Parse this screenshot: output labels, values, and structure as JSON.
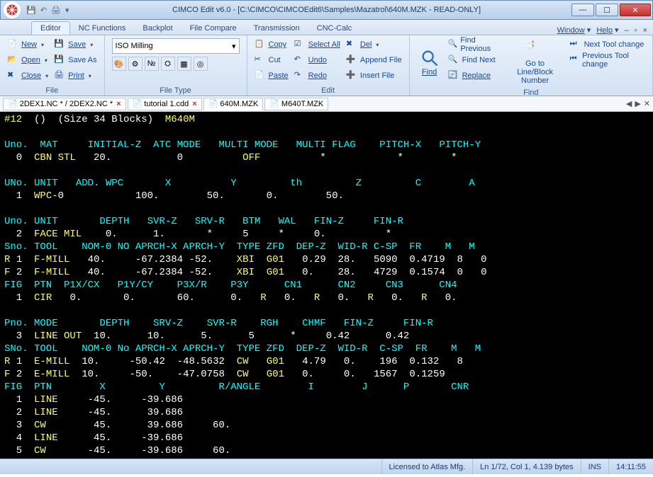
{
  "title": "CIMCO Edit v6.0 - [C:\\CIMCO\\CIMCOEdit6\\Samples\\Mazatrol\\640M.MZK - READ-ONLY]",
  "tabs": {
    "editor": "Editor",
    "nc": "NC Functions",
    "backplot": "Backplot",
    "compare": "File Compare",
    "trans": "Transmission",
    "cnc": "CNC-Calc"
  },
  "tabs_right": {
    "window": "Window",
    "help": "Help"
  },
  "file_grp": {
    "new": "New",
    "save": "Save",
    "open": "Open",
    "saveas": "Save As",
    "close": "Close",
    "print": "Print",
    "label": "File"
  },
  "ft_grp": {
    "selected": "ISO Milling",
    "label": "File Type"
  },
  "edit_grp": {
    "copy": "Copy",
    "selectall": "Select All",
    "del": "Del",
    "cut": "Cut",
    "undo": "Undo",
    "append": "Append File",
    "paste": "Paste",
    "redo": "Redo",
    "insert": "Insert File",
    "label": "Edit"
  },
  "find_grp": {
    "find": "Find",
    "prev": "Find Previous",
    "next": "Find Next",
    "replace": "Replace",
    "goto": "Go to Line/Block Number",
    "ntc": "Next Tool change",
    "ptc": "Previous Tool change",
    "label": "Find"
  },
  "docs": [
    "2DEX1.NC * / 2DEX2.NC *",
    "tutorial 1.cdd",
    "640M.MZK",
    "M640T.MZK"
  ],
  "active_doc": 2,
  "status": {
    "lic": "Licensed to Atlas Mfg.",
    "pos": "Ln 1/72, Col 1, 4.139 bytes",
    "ins": "INS",
    "time": "14:11:55"
  },
  "code": [
    [
      [
        "y",
        "#12  "
      ],
      [
        "w",
        "()  "
      ],
      [
        "w",
        "(Size 34 Blocks)  "
      ],
      [
        "y",
        "M640M"
      ]
    ],
    [],
    [
      [
        "c",
        "Uno."
      ],
      [
        "c",
        "  MAT     INITIAL-Z  "
      ],
      [
        "c",
        "ATC MODE   MULTI MODE   MULTI FLAG    PITCH-X   PITCH-Y"
      ]
    ],
    [
      [
        "w",
        "  0  "
      ],
      [
        "y",
        "CBN STL"
      ],
      [
        "w",
        "   20.           0          "
      ],
      [
        "y",
        "OFF"
      ],
      [
        "w",
        "          *            *        *"
      ]
    ],
    [],
    [
      [
        "c",
        "UNo. UNIT   ADD. WPC       X          Y         th         Z         C        A"
      ]
    ],
    [
      [
        "w",
        "  1  "
      ],
      [
        "y",
        "WPC-"
      ],
      [
        "w",
        "0            100.        50.       0.        50."
      ]
    ],
    [],
    [
      [
        "c",
        "Uno. UNIT       DEPTH   SVR-Z   SRV-R   BTM   WAL   FIN-Z     FIN-R"
      ]
    ],
    [
      [
        "w",
        "  2  "
      ],
      [
        "y",
        "FACE MIL"
      ],
      [
        "w",
        "    0.      1.       *     5     *     0.          *"
      ]
    ],
    [
      [
        "c",
        "Sno. TOOL    NOM-0 NO APRCH-X APRCH-Y  TYPE ZFD  DEP-Z  WID-R C-SP  FR    M   M"
      ]
    ],
    [
      [
        "y",
        "R "
      ],
      [
        "w",
        "1  "
      ],
      [
        "y",
        "F-MILL"
      ],
      [
        "w",
        "   40.     -67.2384 -52.    "
      ],
      [
        "y",
        "XBI  G01"
      ],
      [
        "w",
        "   0.29  28.   5090  0.4719  8   0"
      ]
    ],
    [
      [
        "y",
        "F "
      ],
      [
        "w",
        "2  "
      ],
      [
        "y",
        "F-MILL"
      ],
      [
        "w",
        "   40.     -67.2384 -52.    "
      ],
      [
        "y",
        "XBI  G01"
      ],
      [
        "w",
        "   0.    28.   4729  0.1574  0   0"
      ]
    ],
    [
      [
        "c",
        "FIG  PTN  P1X/CX   P1Y/CY    P3X/R    P3Y      CN1      CN2     CN3      CN4"
      ]
    ],
    [
      [
        "w",
        "  1  "
      ],
      [
        "y",
        "CIR"
      ],
      [
        "w",
        "   0.       0.       60.      0.   "
      ],
      [
        "y",
        "R"
      ],
      [
        "w",
        "   0.   "
      ],
      [
        "y",
        "R"
      ],
      [
        "w",
        "   0.   "
      ],
      [
        "y",
        "R"
      ],
      [
        "w",
        "   0.   "
      ],
      [
        "y",
        "R"
      ],
      [
        "w",
        "   0."
      ]
    ],
    [],
    [
      [
        "c",
        "Pno. MODE       DEPTH    SRV-Z    SVR-R    RGH    CHMF   FIN-Z     FIN-R"
      ]
    ],
    [
      [
        "w",
        "  3  "
      ],
      [
        "y",
        "LINE OUT"
      ],
      [
        "w",
        "  10.      10.      5.      5      *     0.42      0.42"
      ]
    ],
    [
      [
        "c",
        "SNo. TOOL    NOM-0 No APRCH-X APRCH-Y  TYPE ZFD  DEP-Z  WID-R  C-SP  FR    M   M"
      ]
    ],
    [
      [
        "y",
        "R "
      ],
      [
        "w",
        "1  "
      ],
      [
        "y",
        "E-MILL"
      ],
      [
        "w",
        "  10.     -50.42  -48.5632  "
      ],
      [
        "y",
        "CW   G01"
      ],
      [
        "w",
        "   4.79   0.    196  0.132   8"
      ]
    ],
    [
      [
        "y",
        "F "
      ],
      [
        "w",
        "2  "
      ],
      [
        "y",
        "E-MILL"
      ],
      [
        "w",
        "  10.     -50.    -47.0758  "
      ],
      [
        "y",
        "CW   G01"
      ],
      [
        "w",
        "   0.     0.   1567  0.1259"
      ]
    ],
    [
      [
        "c",
        "FIG  PTN        X         Y         R/ANGLE        I        J      P       CNR"
      ]
    ],
    [
      [
        "w",
        "  1  "
      ],
      [
        "y",
        "LINE"
      ],
      [
        "w",
        "     -45.     -39.686"
      ]
    ],
    [
      [
        "w",
        "  2  "
      ],
      [
        "y",
        "LINE"
      ],
      [
        "w",
        "     -45.      39.686"
      ]
    ],
    [
      [
        "w",
        "  3  "
      ],
      [
        "y",
        "CW  "
      ],
      [
        "w",
        "      45.      39.686     60."
      ]
    ],
    [
      [
        "w",
        "  4  "
      ],
      [
        "y",
        "LINE"
      ],
      [
        "w",
        "      45.     -39.686"
      ]
    ],
    [
      [
        "w",
        "  5  "
      ],
      [
        "y",
        "CW  "
      ],
      [
        "w",
        "     -45.     -39.686     60."
      ]
    ]
  ]
}
